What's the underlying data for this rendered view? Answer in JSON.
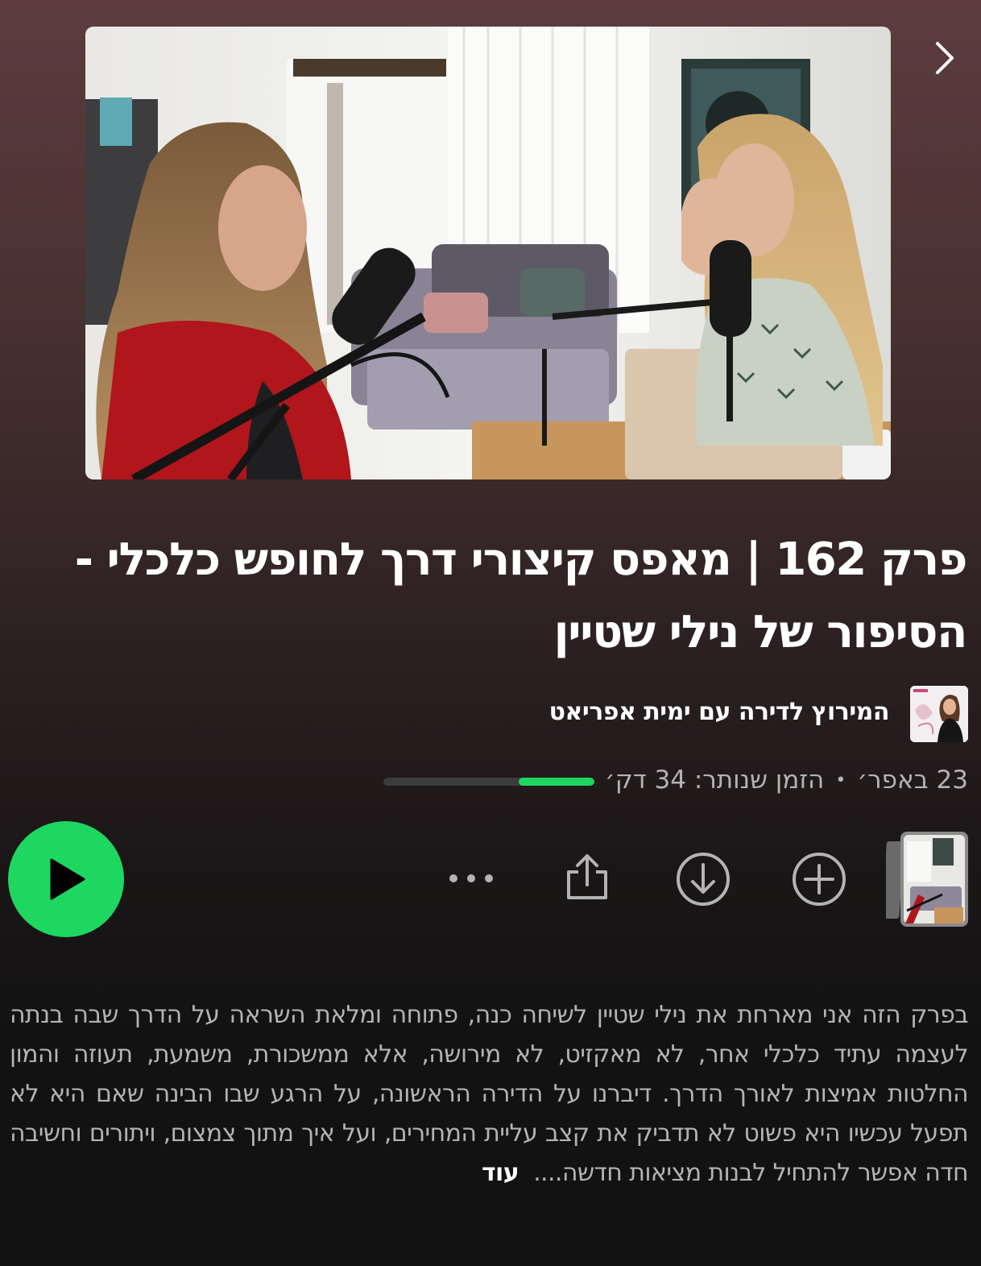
{
  "episode": {
    "title": "פרק 162 | מאפס קיצורי דרך לחופש כלכלי - הסיפור של נילי שטיין",
    "show_name": "המירוץ לדירה עם  ימית אפריאט",
    "date": "23 באפר׳",
    "separator": "•",
    "time_left": "הזמן שנותר: 34 דק׳",
    "progress_fraction": 0.36,
    "description": "בפרק הזה אני מארחת את נילי שטיין לשיחה כנה, פתוחה ומלאת השראה על הדרך שבה בנתה לעצמה עתיד כלכלי אחר, לא מאקזיט, לא מירושה, אלא ממשכורת, משמעת, תעוזה והמון החלטות אמיצות לאורך הדרך. דיברנו על הדירה הראשונה, על הרגע שבו הבינה שאם היא לא תפעל עכשיו היא פשוט לא תדביק את קצב עליית המחירים, ועל איך מתוך צמצום, ויתורים וחשיבה חדה אפשר להתחיל לבנות מציאות חדשה....",
    "more_label": "עוד"
  },
  "controls": {
    "play_icon": "play-icon",
    "more_icon": "more-options-icon",
    "share_icon": "share-icon",
    "download_icon": "download-icon",
    "add_icon": "add-icon",
    "next_icon": "chevron-right-icon"
  },
  "colors": {
    "accent": "#1ed760",
    "text_primary": "#ffffff",
    "text_secondary": "#b3b3b3",
    "background": "#121212"
  }
}
